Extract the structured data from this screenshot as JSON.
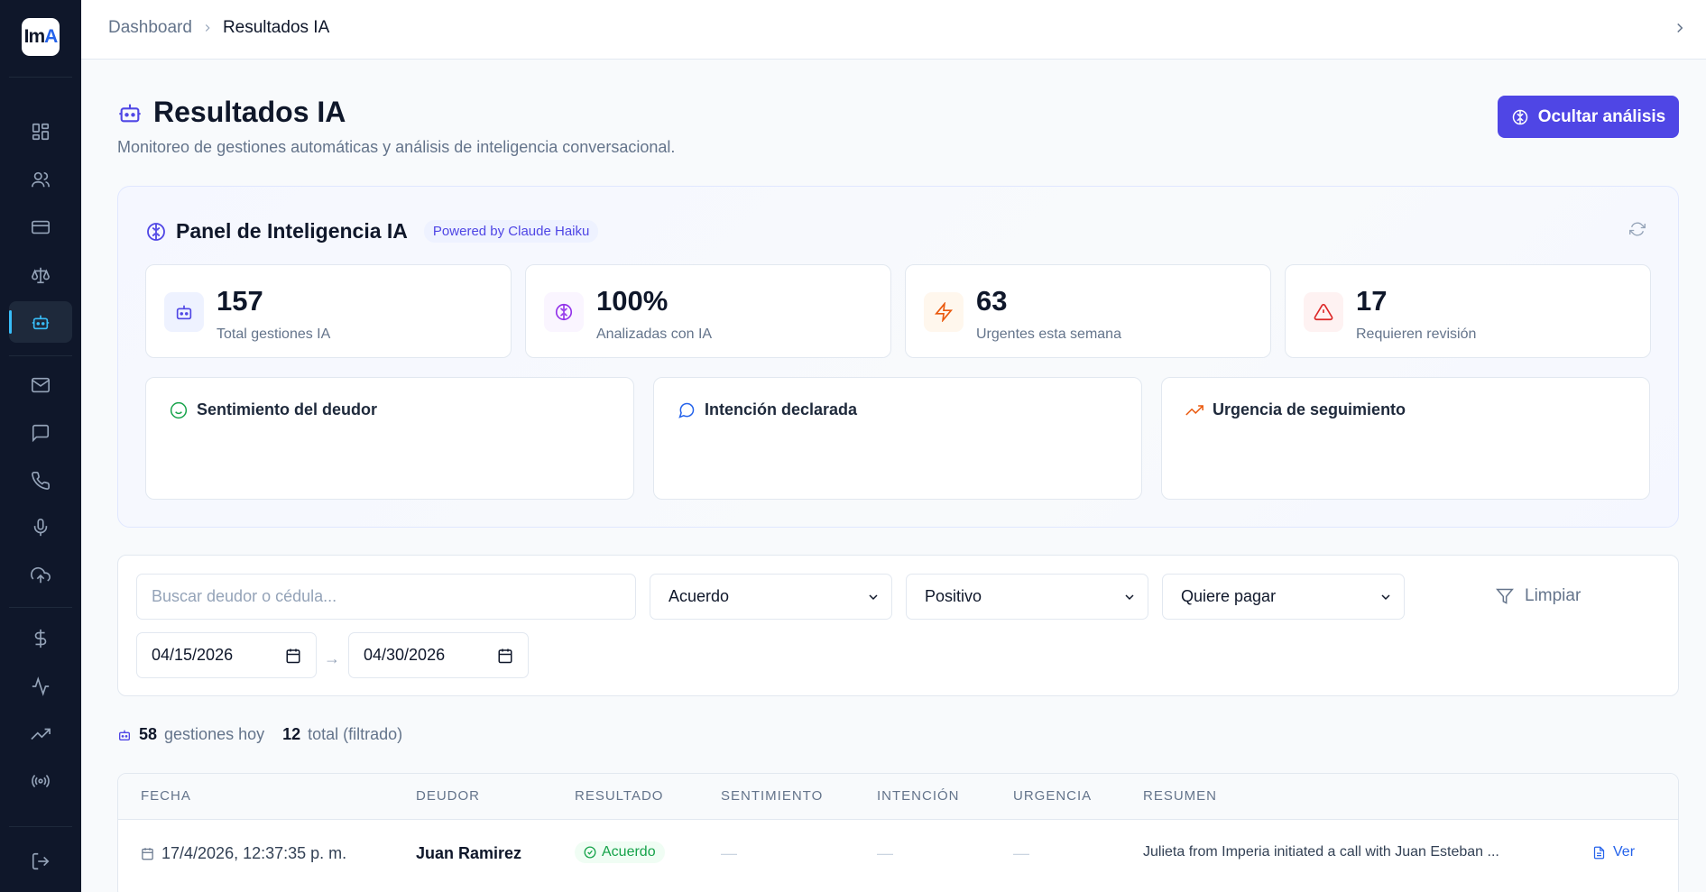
{
  "sidebar": {
    "logo_main": "Im",
    "logo_accent": "A",
    "items": [
      {
        "icon": "dashboard-icon"
      },
      {
        "icon": "users-icon"
      },
      {
        "icon": "credit-card-icon"
      },
      {
        "icon": "scale-icon"
      },
      {
        "icon": "bot-icon",
        "active": true
      },
      {
        "icon": "mail-icon"
      },
      {
        "icon": "message-icon"
      },
      {
        "icon": "phone-icon"
      },
      {
        "icon": "mic-icon"
      },
      {
        "icon": "upload-cloud-icon"
      },
      {
        "icon": "dollar-icon"
      },
      {
        "icon": "activity-icon"
      },
      {
        "icon": "trending-up-icon"
      },
      {
        "icon": "broadcast-icon"
      },
      {
        "icon": "logout-icon"
      }
    ],
    "accent_color": "#38bdf8"
  },
  "breadcrumb": {
    "root": "Dashboard",
    "current": "Resultados IA"
  },
  "header": {
    "title": "Resultados IA",
    "subtitle": "Monitoreo de gestiones automáticas y análisis de inteligencia conversacional.",
    "toggle_button": "Ocultar análisis"
  },
  "panel": {
    "title": "Panel de Inteligencia IA",
    "badge": "Powered by Claude Haiku",
    "stats": [
      {
        "value": "157",
        "label": "Total gestiones IA",
        "icon": "bot-icon",
        "color": "#4f46e5"
      },
      {
        "value": "100%",
        "label": "Analizadas con IA",
        "icon": "brain-icon",
        "color": "#9333ea"
      },
      {
        "value": "63",
        "label": "Urgentes esta semana",
        "icon": "lightning-icon",
        "color": "#ea580c"
      },
      {
        "value": "17",
        "label": "Requieren revisión",
        "icon": "alert-triangle-icon",
        "color": "#dc2626"
      }
    ],
    "categories": [
      {
        "title": "Sentimiento del deudor",
        "icon": "smile-icon",
        "color": "#16a34a"
      },
      {
        "title": "Intención declarada",
        "icon": "message-circle-icon",
        "color": "#2563eb"
      },
      {
        "title": "Urgencia de seguimiento",
        "icon": "trending-up-icon",
        "color": "#ea580c"
      }
    ]
  },
  "filters": {
    "search_placeholder": "Buscar deudor o cédula...",
    "resultado": "Acuerdo",
    "sentimiento": "Positivo",
    "intencion": "Quiere pagar",
    "clear_label": "Limpiar",
    "date_from": "04/15/2026",
    "date_to": "04/30/2026",
    "date_separator": "→"
  },
  "counters": {
    "today_count": "58",
    "today_label": "gestiones hoy",
    "total_count": "12",
    "total_label": "total (filtrado)"
  },
  "table": {
    "columns": [
      "FECHA",
      "DEUDOR",
      "RESULTADO",
      "SENTIMIENTO",
      "INTENCIÓN",
      "URGENCIA",
      "RESUMEN"
    ],
    "rows": [
      {
        "fecha": "17/4/2026, 12:37:35 p. m.",
        "deudor": "Juan Ramirez",
        "resultado": "Acuerdo",
        "sentimiento": "—",
        "intencion": "—",
        "urgencia": "—",
        "resumen": "Julieta from Imperia initiated a call with Juan Esteban ...",
        "action": "Ver"
      }
    ]
  }
}
